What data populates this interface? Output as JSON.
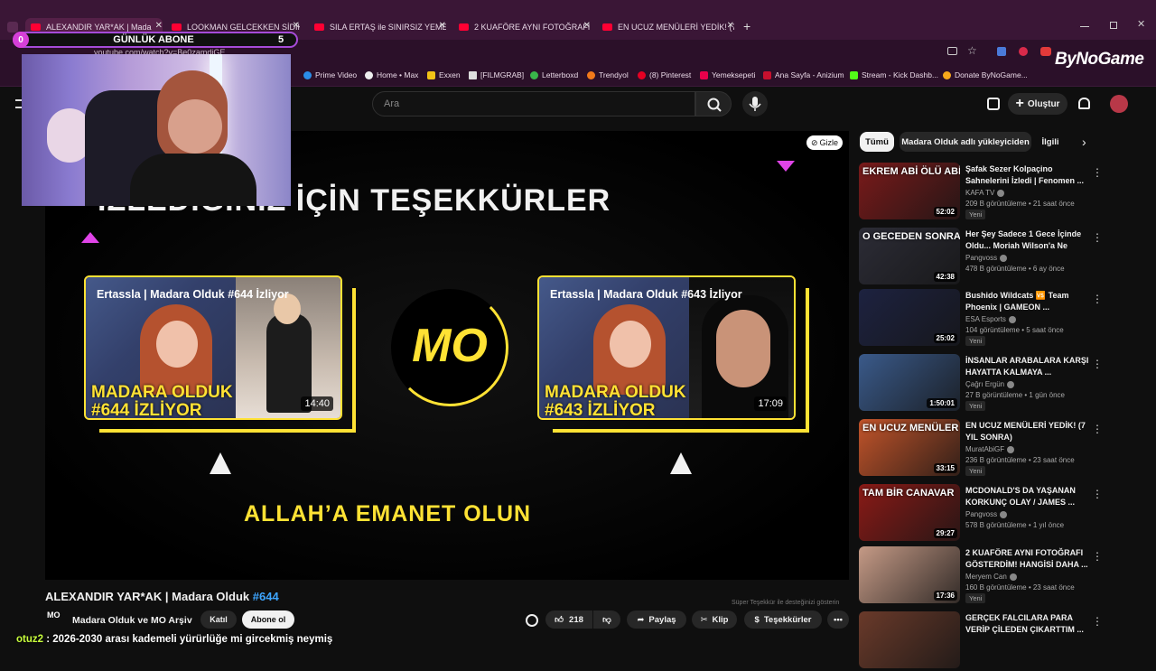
{
  "browser": {
    "tabs": [
      {
        "title": "ALEXANDIR YAR*AK | Mada",
        "active": true
      },
      {
        "title": "LOOKMAN GELCEKKEN SİDİKİ",
        "active": false
      },
      {
        "title": "SILA ERTAŞ ile SINIRSIZ YEMEK",
        "active": false
      },
      {
        "title": "2 KUAFÖRE AYNI FOTOĞRAFI G",
        "active": false
      },
      {
        "title": "EN UCUZ MENÜLERİ YEDİK! (7",
        "active": false
      }
    ],
    "new_tab": "+",
    "url": "youtube.com/watch?v=Be0zamdjGE",
    "bookmarks": [
      "Prime Video",
      "Home • Max",
      "Exxen",
      "[FILMGRAB]",
      "Letterboxd",
      "Trendyol",
      "(8) Pinterest",
      "Yemeksepeti",
      "Ana Sayfa - Anizium",
      "Stream - Kick Dashb...",
      "Donate ByNoGame..."
    ]
  },
  "overlay": {
    "sub_current": "0",
    "sub_label": "GÜNLÜK ABONE",
    "sub_goal": "5",
    "brand": "ByNoGame"
  },
  "youtube": {
    "search_placeholder": "Ara",
    "create_label": "Oluştur",
    "hide_label": "Gizle",
    "end_title": "İZLEDİĞİNİZ İÇİN TEŞEKKÜRLER",
    "end_footer": "ALLAH’A EMANET OLUN",
    "logo": "MO",
    "cards": [
      {
        "title": "Ertassla | Madara Olduk #644 İzliyor",
        "big1": "MADARA OLDUK",
        "big2": "#644 İZLİYOR",
        "duration": "14:40"
      },
      {
        "title": "Ertassla | Madara Olduk #643 İzliyor",
        "big1": "MADARA OLDUK",
        "big2": "#643 İZLİYOR",
        "duration": "17:09"
      }
    ],
    "video_title": "ALEXANDIR YAR*AK | Madara Olduk",
    "video_hash": "#644",
    "channel_avatar": "MO",
    "channel_name": "Madara Olduk ve MO Arşiv",
    "join_label": "Katıl",
    "subscribe_label": "Abone ol",
    "likes": "218",
    "share_label": "Paylaş",
    "clip_label": "Klip",
    "thanks_label": "Teşekkürler",
    "tooltip": "Süper Teşekkür ile desteğinizi gösterin",
    "chips": [
      "Tümü",
      "Madara Olduk adlı yükleyiciden",
      "İlgili"
    ],
    "recs": [
      {
        "title": "Şafak Sezer Kolpaçino Sahnelerini İzledi | Fenomen ...",
        "channel": "KAFA TV",
        "meta": "209 B görüntüleme • 21 saat önce",
        "new": "Yeni",
        "dur": "52:02",
        "thumb_text": "EKREM ABİ ÖLÜ ABİ",
        "bg": "#7a1a1a"
      },
      {
        "title": "Her Şey Sadece 1 Gece İçinde Oldu... Moriah Wilson'a Ne Oldu?",
        "channel": "Pangvoss",
        "meta": "478 B görüntüleme • 6 ay önce",
        "new": "",
        "dur": "42:38",
        "thumb_text": "O GECEDEN SONRA",
        "bg": "#2c2c36"
      },
      {
        "title": "Bushido Wildcats 🆚 Team Phoenix | GAMEON ...",
        "channel": "ESA Esports",
        "meta": "104 görüntüleme • 5 saat önce",
        "new": "Yeni",
        "dur": "25:02",
        "thumb_text": "",
        "bg": "#1d2240"
      },
      {
        "title": "İNSANLAR ARABALARA KARŞI HAYATTA KALMAYA ...",
        "channel": "Çağrı Ergün",
        "meta": "27 B görüntüleme • 1 gün önce",
        "new": "Yeni",
        "dur": "1:50:01",
        "thumb_text": "",
        "bg": "#3a5a8a"
      },
      {
        "title": "EN UCUZ MENÜLERİ YEDİK! (7 YIL SONRA)",
        "channel": "MuratAbiGF",
        "meta": "236 B görüntüleme • 23 saat önce",
        "new": "Yeni",
        "dur": "33:15",
        "thumb_text": "EN UCUZ MENÜLER",
        "bg": "#c2542a"
      },
      {
        "title": "MCDONALD'S DA YAŞANAN KORKUNÇ OLAY / JAMES ...",
        "channel": "Pangvoss",
        "meta": "578 B görüntüleme • 1 yıl önce",
        "new": "",
        "dur": "29:27",
        "thumb_text": "TAM BİR CANAVAR",
        "bg": "#8a1a16"
      },
      {
        "title": "2 KUAFÖRE AYNI FOTOĞRAFI GÖSTERDİM! HANGİSİ DAHA ...",
        "channel": "Meryem Can",
        "meta": "160 B görüntüleme • 23 saat önce",
        "new": "Yeni",
        "dur": "17:36",
        "thumb_text": "",
        "bg": "#c59a86"
      },
      {
        "title": "GERÇEK FALCILARA PARA VERİP ÇİLEDEN ÇIKARTTIM ...",
        "channel": "",
        "meta": "",
        "new": "",
        "dur": "",
        "thumb_text": "",
        "bg": "#6a3a2a"
      }
    ]
  },
  "chat": {
    "user": "otuz2",
    "message": " : 2026-2030 arası kademeli yürürlüğe mi gircekmiş neymiş"
  },
  "colors": {
    "accent_yellow": "#ffe234",
    "tab_bg": "#3a1636",
    "yt_red": "#ff0033"
  }
}
